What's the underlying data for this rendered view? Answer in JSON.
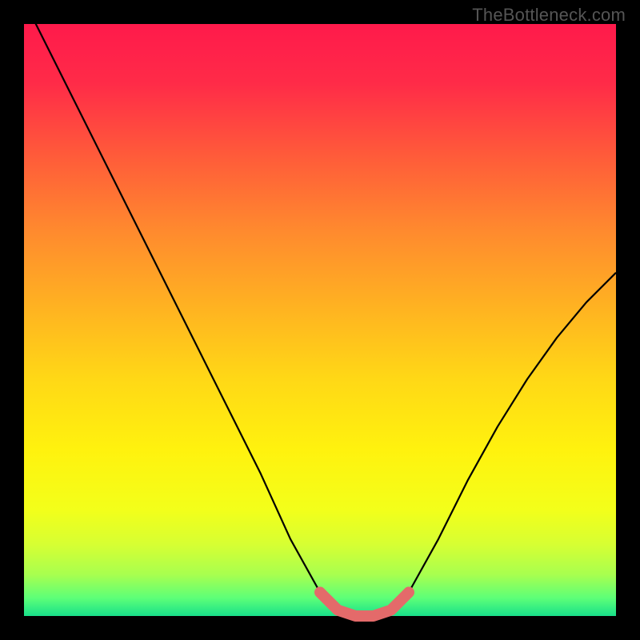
{
  "watermark": "TheBottleneck.com",
  "chart_data": {
    "type": "line",
    "title": "",
    "xlabel": "",
    "ylabel": "",
    "xlim": [
      0,
      1
    ],
    "ylim": [
      0,
      1
    ],
    "series": [
      {
        "name": "bottleneck-curve",
        "x": [
          0.0,
          0.05,
          0.1,
          0.15,
          0.2,
          0.25,
          0.3,
          0.35,
          0.4,
          0.45,
          0.5,
          0.53,
          0.56,
          0.59,
          0.62,
          0.65,
          0.7,
          0.75,
          0.8,
          0.85,
          0.9,
          0.95,
          1.0
        ],
        "values": [
          1.04,
          0.94,
          0.84,
          0.74,
          0.64,
          0.54,
          0.44,
          0.34,
          0.24,
          0.13,
          0.04,
          0.01,
          0.0,
          0.0,
          0.01,
          0.04,
          0.13,
          0.23,
          0.32,
          0.4,
          0.47,
          0.53,
          0.58
        ]
      }
    ],
    "highlight": {
      "name": "optimal-zone",
      "x": [
        0.5,
        0.53,
        0.56,
        0.59,
        0.62,
        0.65
      ],
      "values": [
        0.04,
        0.01,
        0.0,
        0.0,
        0.01,
        0.04
      ],
      "color": "#e46a6a"
    },
    "gradient_stops": [
      {
        "pos": 0.0,
        "color": "#ff1a4b"
      },
      {
        "pos": 0.1,
        "color": "#ff2b48"
      },
      {
        "pos": 0.22,
        "color": "#ff5a3a"
      },
      {
        "pos": 0.35,
        "color": "#ff8a2e"
      },
      {
        "pos": 0.48,
        "color": "#ffb321"
      },
      {
        "pos": 0.6,
        "color": "#ffd816"
      },
      {
        "pos": 0.72,
        "color": "#fff20e"
      },
      {
        "pos": 0.82,
        "color": "#f3ff1a"
      },
      {
        "pos": 0.88,
        "color": "#d6ff33"
      },
      {
        "pos": 0.93,
        "color": "#a8ff4f"
      },
      {
        "pos": 0.97,
        "color": "#5cff78"
      },
      {
        "pos": 1.0,
        "color": "#18e08a"
      }
    ]
  }
}
